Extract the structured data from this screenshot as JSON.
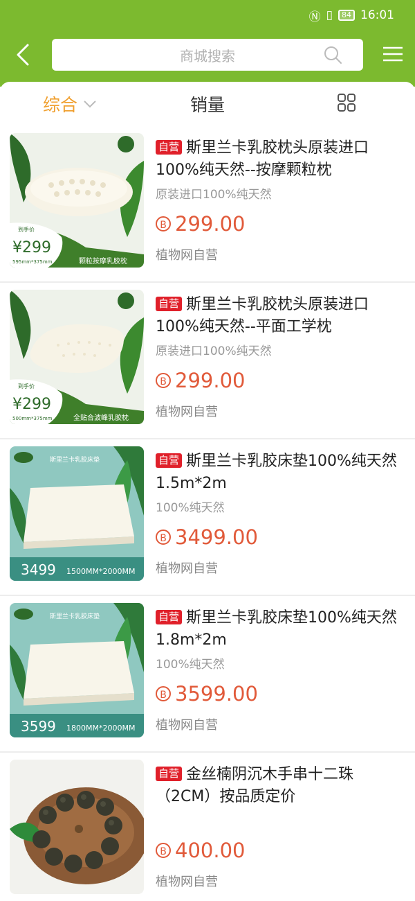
{
  "status": {
    "battery": "84",
    "time": "16:01"
  },
  "search": {
    "placeholder": "商城搜索"
  },
  "sort": {
    "composite": "综合",
    "sales": "销量"
  },
  "colors": {
    "header": "#7cba2f",
    "accent": "#f0a030",
    "price": "#e15a3a",
    "badge": "#e0202a"
  },
  "products": [
    {
      "badge": "自营",
      "title": "斯里兰卡乳胶枕头原装进口100%纯天然--按摩颗粒枕",
      "subtitle": "原装进口100%纯天然",
      "price": "299.00",
      "seller": "植物网自营",
      "thumb": {
        "price_tag_label": "到手价",
        "price_tag": "¥299",
        "size": "595mm*375mm",
        "caption": "颗粒按摩乳胶枕"
      }
    },
    {
      "badge": "自营",
      "title": "斯里兰卡乳胶枕头原装进口100%纯天然--平面工学枕",
      "subtitle": "原装进口100%纯天然",
      "price": "299.00",
      "seller": "植物网自营",
      "thumb": {
        "price_tag_label": "到手价",
        "price_tag": "¥299",
        "size": "500mm*375mm",
        "caption": "全贴合波峰乳胶枕"
      }
    },
    {
      "badge": "自营",
      "title": "斯里兰卡乳胶床垫100%纯天然1.5m*2m",
      "subtitle": "100%纯天然",
      "price": "3499.00",
      "seller": "植物网自营",
      "thumb": {
        "price_tag": "3499",
        "size": "1500MM*2000MM",
        "caption": "斯里兰卡乳胶床垫"
      }
    },
    {
      "badge": "自营",
      "title": "斯里兰卡乳胶床垫100%纯天然1.8m*2m",
      "subtitle": "100%纯天然",
      "price": "3599.00",
      "seller": "植物网自营",
      "thumb": {
        "price_tag": "3599",
        "size": "1800MM*2000MM",
        "caption": "斯里兰卡乳胶床垫"
      }
    },
    {
      "badge": "自营",
      "title": "金丝楠阴沉木手串十二珠（2CM）按品质定价",
      "subtitle": "",
      "price": "400.00",
      "seller": "植物网自营"
    }
  ]
}
